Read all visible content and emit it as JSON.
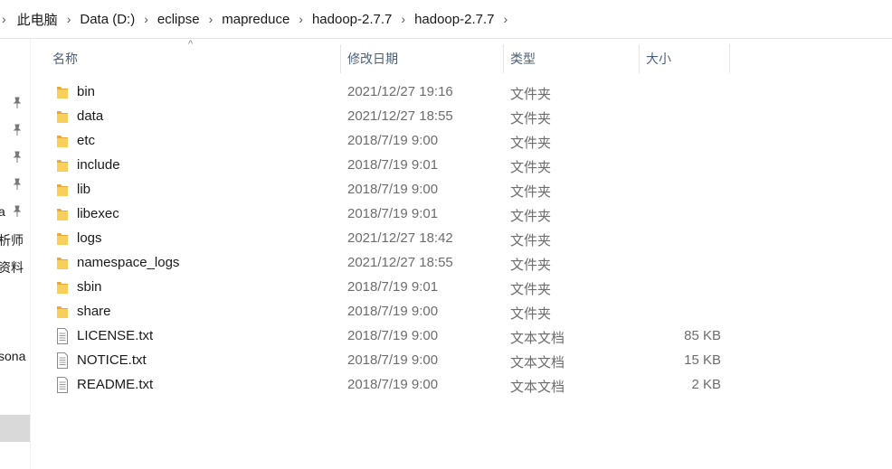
{
  "breadcrumb": {
    "items": [
      "此电脑",
      "Data (D:)",
      "eclipse",
      "mapreduce",
      "hadoop-2.7.7",
      "hadoop-2.7.7"
    ]
  },
  "nav": {
    "items": [
      "",
      "",
      "",
      "",
      "a",
      "析师",
      "资料",
      "sona"
    ]
  },
  "columns": {
    "name": "名称",
    "date": "修改日期",
    "type": "类型",
    "size": "大小"
  },
  "colors": {
    "folder": "#f5c542",
    "header_text": "#4c607a",
    "meta_text": "#6d6d6d",
    "selected_nav": "#d9d9d9"
  },
  "files": [
    {
      "name": "bin",
      "date": "2021/12/27 19:16",
      "type": "文件夹",
      "size": "",
      "icon": "folder-icon"
    },
    {
      "name": "data",
      "date": "2021/12/27 18:55",
      "type": "文件夹",
      "size": "",
      "icon": "folder-icon"
    },
    {
      "name": "etc",
      "date": "2018/7/19 9:00",
      "type": "文件夹",
      "size": "",
      "icon": "folder-icon"
    },
    {
      "name": "include",
      "date": "2018/7/19 9:01",
      "type": "文件夹",
      "size": "",
      "icon": "folder-icon"
    },
    {
      "name": "lib",
      "date": "2018/7/19 9:00",
      "type": "文件夹",
      "size": "",
      "icon": "folder-icon"
    },
    {
      "name": "libexec",
      "date": "2018/7/19 9:01",
      "type": "文件夹",
      "size": "",
      "icon": "folder-icon"
    },
    {
      "name": "logs",
      "date": "2021/12/27 18:42",
      "type": "文件夹",
      "size": "",
      "icon": "folder-icon"
    },
    {
      "name": "namespace_logs",
      "date": "2021/12/27 18:55",
      "type": "文件夹",
      "size": "",
      "icon": "folder-icon"
    },
    {
      "name": "sbin",
      "date": "2018/7/19 9:01",
      "type": "文件夹",
      "size": "",
      "icon": "folder-icon"
    },
    {
      "name": "share",
      "date": "2018/7/19 9:00",
      "type": "文件夹",
      "size": "",
      "icon": "folder-icon"
    },
    {
      "name": "LICENSE.txt",
      "date": "2018/7/19 9:00",
      "type": "文本文档",
      "size": "85 KB",
      "icon": "text-file-icon"
    },
    {
      "name": "NOTICE.txt",
      "date": "2018/7/19 9:00",
      "type": "文本文档",
      "size": "15 KB",
      "icon": "text-file-icon"
    },
    {
      "name": "README.txt",
      "date": "2018/7/19 9:00",
      "type": "文本文档",
      "size": "2 KB",
      "icon": "text-file-icon"
    }
  ]
}
